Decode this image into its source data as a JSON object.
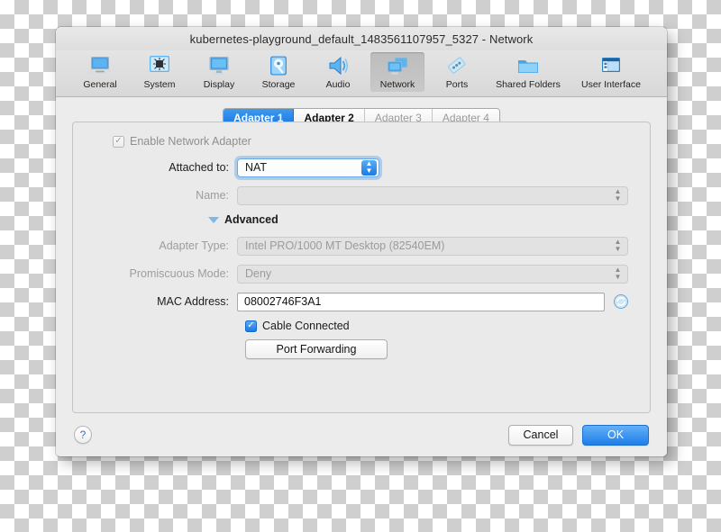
{
  "window": {
    "title": "kubernetes-playground_default_1483561107957_5327 - Network"
  },
  "toolbar": {
    "items": [
      {
        "label": "General",
        "icon": "general-icon",
        "selected": false
      },
      {
        "label": "System",
        "icon": "system-icon",
        "selected": false
      },
      {
        "label": "Display",
        "icon": "display-icon",
        "selected": false
      },
      {
        "label": "Storage",
        "icon": "storage-icon",
        "selected": false
      },
      {
        "label": "Audio",
        "icon": "audio-icon",
        "selected": false
      },
      {
        "label": "Network",
        "icon": "network-icon",
        "selected": true
      },
      {
        "label": "Ports",
        "icon": "ports-icon",
        "selected": false
      },
      {
        "label": "Shared Folders",
        "icon": "shared-folders-icon",
        "selected": false
      },
      {
        "label": "User Interface",
        "icon": "user-interface-icon",
        "selected": false
      }
    ]
  },
  "tabs": [
    {
      "label": "Adapter 1",
      "state": "active"
    },
    {
      "label": "Adapter 2",
      "state": "enabled"
    },
    {
      "label": "Adapter 3",
      "state": "disabled"
    },
    {
      "label": "Adapter 4",
      "state": "disabled"
    }
  ],
  "form": {
    "enable_adapter": {
      "label": "Enable Network Adapter",
      "checked": true,
      "enabled": false
    },
    "attached_to": {
      "label": "Attached to:",
      "value": "NAT",
      "enabled": true,
      "focused": true
    },
    "name": {
      "label": "Name:",
      "value": "",
      "enabled": false
    },
    "advanced": {
      "label": "Advanced",
      "expanded": true,
      "icon": "disclosure-triangle-down-icon"
    },
    "adapter_type": {
      "label": "Adapter Type:",
      "value": "Intel PRO/1000 MT Desktop (82540EM)",
      "enabled": false
    },
    "promiscuous_mode": {
      "label": "Promiscuous Mode:",
      "value": "Deny",
      "enabled": false
    },
    "mac_address": {
      "label": "MAC Address:",
      "value": "08002746F3A1",
      "enabled": true,
      "regenerate_icon": "refresh-icon"
    },
    "cable_connected": {
      "label": "Cable Connected",
      "checked": true,
      "enabled": true
    },
    "port_forwarding": {
      "label": "Port Forwarding"
    }
  },
  "footer": {
    "help_label": "?",
    "cancel_label": "Cancel",
    "ok_label": "OK"
  },
  "colors": {
    "accent_blue": "#1e7ee8",
    "tab_active": "#1a74e0",
    "checkbox_on": "#1b7ae5",
    "window_bg": "#ececec",
    "panel_bg": "#eaeaea"
  }
}
